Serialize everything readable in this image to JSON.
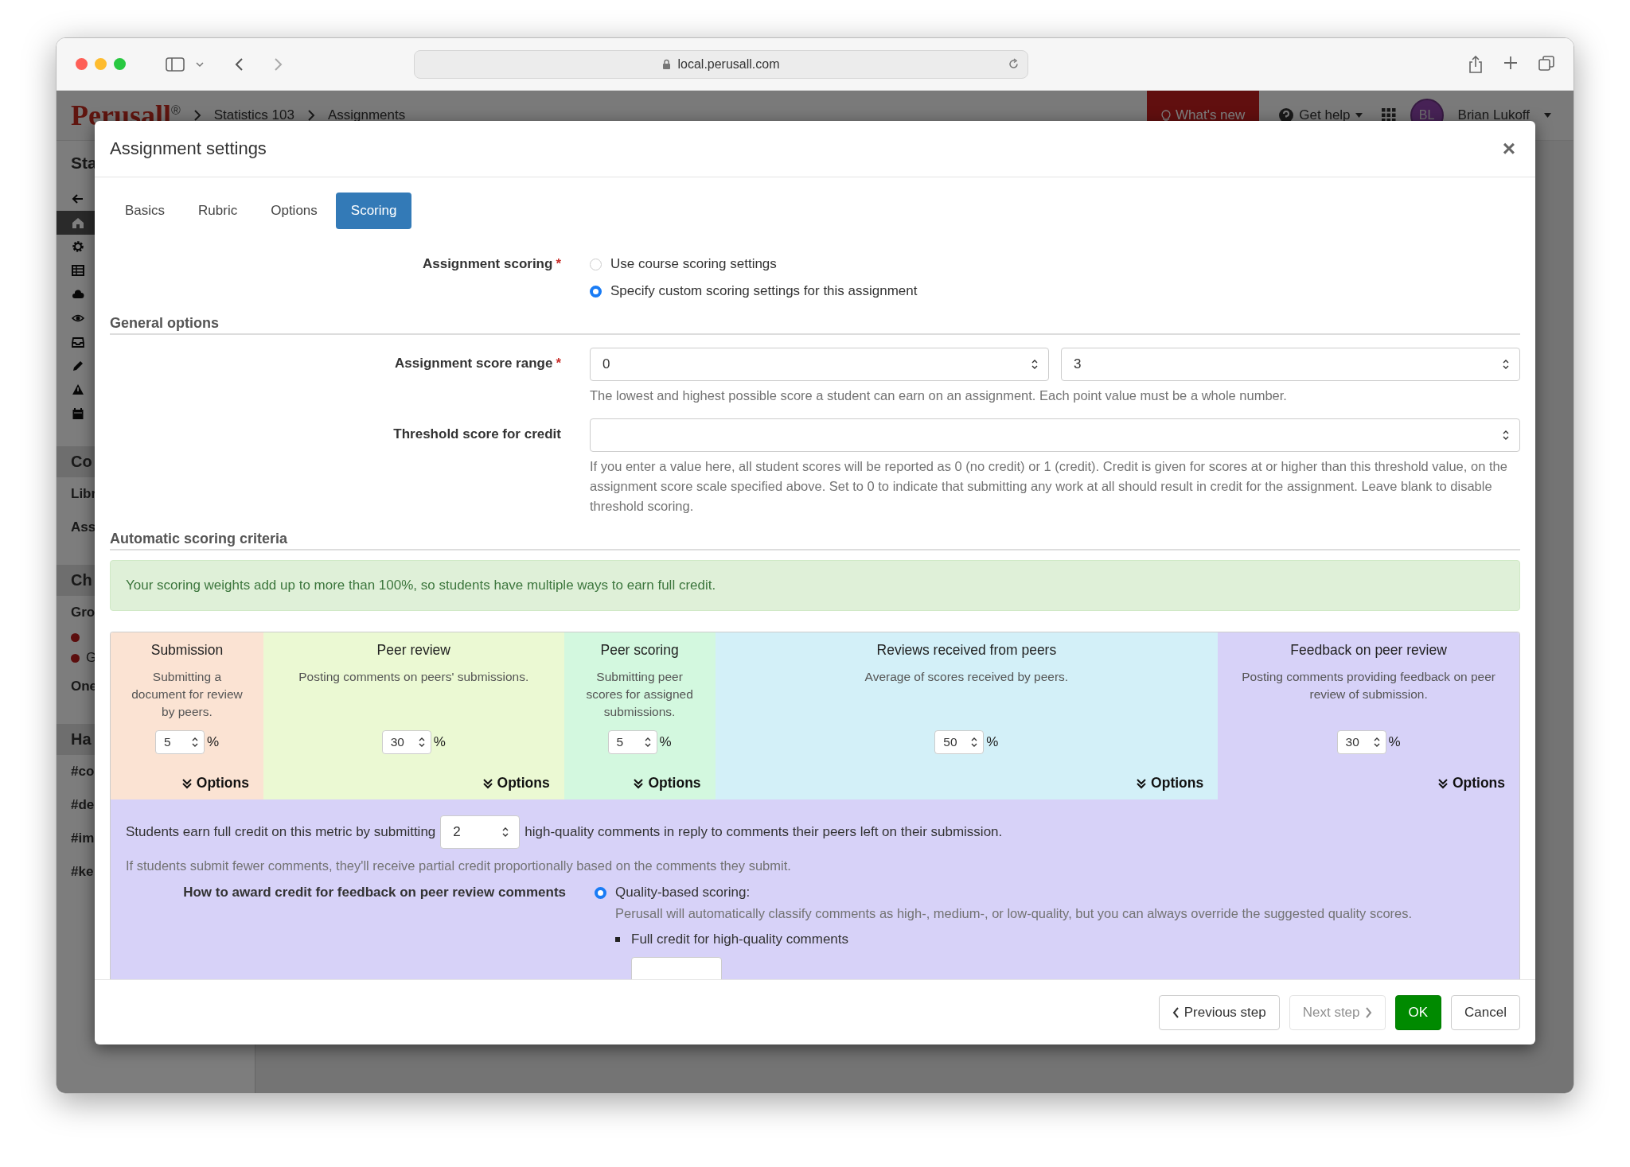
{
  "browser": {
    "url": "local.perusall.com"
  },
  "app_header": {
    "logo": "Perusall",
    "logo_mark": "®",
    "breadcrumbs": [
      "Statistics 103",
      "Assignments"
    ],
    "whats_new": "What's new",
    "get_help": "Get help",
    "avatar": "BL",
    "user": "Brian Lukoff"
  },
  "sidebar": {
    "title": "Sta",
    "nav_items": [
      {
        "selected": false
      },
      {
        "selected": true
      },
      {
        "selected": false
      },
      {
        "selected": false
      },
      {
        "selected": false
      },
      {
        "selected": false
      },
      {
        "selected": false
      },
      {
        "selected": false
      },
      {
        "selected": false
      },
      {
        "selected": false
      }
    ],
    "sections": [
      {
        "heading": "Co",
        "items": [
          {
            "kind": "text",
            "label": "Libr"
          },
          {
            "kind": "text",
            "label": "Ass"
          }
        ]
      },
      {
        "heading": "Ch",
        "items": [
          {
            "kind": "text",
            "label": "Gro"
          },
          {
            "kind": "dot"
          },
          {
            "kind": "dot",
            "label": "G"
          },
          {
            "kind": "text",
            "label": "One"
          }
        ]
      },
      {
        "heading": "Ha",
        "items": [
          {
            "kind": "text",
            "label": "#co"
          },
          {
            "kind": "text",
            "label": "#de"
          },
          {
            "kind": "text",
            "label": "#im"
          },
          {
            "kind": "text",
            "label": "#ke"
          }
        ]
      }
    ]
  },
  "modal": {
    "title": "Assignment settings",
    "close": "×",
    "tabs": [
      {
        "label": "Basics",
        "selected": false
      },
      {
        "label": "Rubric",
        "selected": false
      },
      {
        "label": "Options",
        "selected": false
      },
      {
        "label": "Scoring",
        "selected": true
      }
    ],
    "assignment_scoring": {
      "label": "Assignment scoring",
      "required_mark": "*",
      "options": [
        {
          "label": "Use course scoring settings",
          "selected": false
        },
        {
          "label": "Specify custom scoring settings for this assignment",
          "selected": true
        }
      ]
    },
    "general_options": {
      "heading": "General options",
      "score_range": {
        "label": "Assignment score range",
        "required_mark": "*",
        "min": "0",
        "max": "3",
        "help": "The lowest and highest possible score a student can earn on an assignment. Each point value must be a whole number."
      },
      "threshold": {
        "label": "Threshold score for credit",
        "help": "If you enter a value here, all student scores will be reported as 0 (no credit) or 1 (credit). Credit is given for scores at or higher than this threshold value, on the assignment score scale specified above. Set to 0 to indicate that submitting any work at all should result in credit for the assignment. Leave blank to disable threshold scoring."
      }
    },
    "automatic": {
      "heading": "Automatic scoring criteria",
      "alert": "Your scoring weights add up to more than 100%, so students have multiple ways to earn full credit.",
      "criteria": [
        {
          "title": "Submission",
          "description": "Submitting a document for review by peers.",
          "weight": "5",
          "unit": "%",
          "options": "Options",
          "color": "#fbe3d3"
        },
        {
          "title": "Peer review",
          "description": "Posting comments on peers' submissions.",
          "weight": "30",
          "unit": "%",
          "options": "Options",
          "color": "#ebf9d3"
        },
        {
          "title": "Peer scoring",
          "description": "Submitting peer scores for assigned submissions.",
          "weight": "5",
          "unit": "%",
          "options": "Options",
          "color": "#d3f8df"
        },
        {
          "title": "Reviews received from peers",
          "description": "Average of scores received by peers.",
          "weight": "50",
          "unit": "%",
          "options": "Options",
          "color": "#d3f0f8"
        },
        {
          "title": "Feedback on peer review",
          "description": "Posting comments providing feedback on peer review of submission.",
          "weight": "30",
          "unit": "%",
          "options": "Options",
          "color": "#d7d2f8"
        }
      ]
    },
    "feedback_panel": {
      "sentence_start": "Students earn full credit on this metric by submitting",
      "count": "2",
      "sentence_end": "high-quality comments in reply to comments their peers left on their submission.",
      "note": "If students submit fewer comments, they'll receive partial credit proportionally based on the comments they submit.",
      "award_label": "How to award credit for feedback on peer review comments",
      "award_options": [
        {
          "label": "Quality-based scoring:",
          "selected": true,
          "description": "Perusall will automatically classify comments as high-, medium-, or low-quality, but you can always override the suggested quality scores.",
          "bullets": [
            "Full credit for high-quality comments"
          ]
        }
      ]
    },
    "footer": {
      "buttons": [
        {
          "label": "Previous step",
          "kind": "prev",
          "disabled": false
        },
        {
          "label": "Next step",
          "kind": "next",
          "disabled": true
        },
        {
          "label": "OK",
          "kind": "primary",
          "disabled": false
        },
        {
          "label": "Cancel",
          "kind": "default",
          "disabled": false
        }
      ]
    }
  }
}
